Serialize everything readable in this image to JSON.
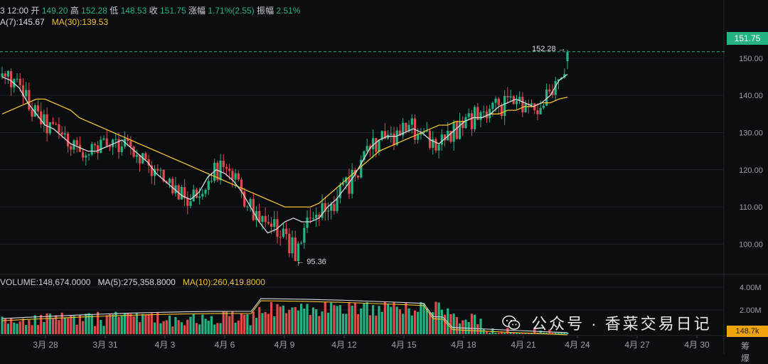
{
  "header": {
    "time": "3 12:00",
    "open_label": "开",
    "open": "149.20",
    "high_label": "高",
    "high": "152.28",
    "low_label": "低",
    "low": "148.53",
    "close_label": "收",
    "close": "151.75",
    "change_label": "涨幅",
    "change": "1.71%(2.55)",
    "amp_label": "振幅",
    "amp": "2.51%"
  },
  "ma_line": {
    "ma7": "A(7):145.67",
    "ma30": "MA(30):139.53"
  },
  "volume_line": {
    "volume": "VOLUME:148,674.0000",
    "ma5": "MA(5):275,358.8000",
    "ma10": "MA(10):260,419.8000"
  },
  "price_tag": "151.75",
  "volume_tag": "148.7k",
  "right_extra": "筹 爆",
  "high_marker": "152.28",
  "low_marker": "95.36",
  "watermark": "公众号 · 香菜交易日记",
  "colors": {
    "up": "#26b383",
    "down": "#e24a4a",
    "ma7": "#d7d9de",
    "ma30": "#f1c232",
    "bg": "#0c0d10"
  },
  "chart_data": {
    "type": "candlestick",
    "price_axis": {
      "ticks": [
        100,
        110,
        120,
        130,
        140,
        150
      ],
      "range": [
        93,
        158
      ]
    },
    "volume_axis": {
      "ticks": [
        "2.00M",
        "4.00M"
      ]
    },
    "x_axis_dates": [
      "3月 28",
      "3月 31",
      "4月 3",
      "4月 6",
      "4月 9",
      "4月 12",
      "4月 15",
      "4月 18",
      "4月 21",
      "4月 24",
      "4月 27",
      "4月 30"
    ],
    "current_price": 151.75,
    "high": 152.28,
    "low": 95.36,
    "ma7_series": [
      145,
      144,
      142,
      138,
      135,
      132,
      131,
      129,
      127,
      126,
      125,
      125,
      126,
      127,
      128,
      126,
      124,
      122,
      119,
      117,
      115,
      113,
      112,
      114,
      118,
      120,
      119,
      117,
      114,
      110,
      106,
      103,
      104,
      106,
      107,
      106,
      106,
      107,
      110,
      112,
      115,
      118,
      122,
      126,
      128,
      129,
      129,
      130,
      131,
      130,
      128,
      127,
      129,
      131,
      133,
      134,
      134,
      135,
      137,
      138,
      139,
      138,
      137,
      138,
      140,
      144,
      145.67
    ],
    "ma30_series": [
      135,
      136,
      137,
      138,
      139,
      139,
      138,
      137,
      136,
      134,
      133,
      132,
      131,
      130,
      129,
      128,
      127,
      126,
      125,
      124,
      123,
      122,
      121,
      120,
      119,
      118,
      117,
      116,
      115,
      114,
      113,
      112,
      111,
      110,
      110,
      110,
      110,
      111,
      113,
      115,
      117,
      119,
      121,
      123,
      125,
      126,
      127,
      128,
      129,
      130,
      131,
      132,
      132,
      133,
      133,
      134,
      134,
      135,
      135,
      136,
      136,
      137,
      137,
      138,
      138,
      139,
      139.53
    ]
  }
}
